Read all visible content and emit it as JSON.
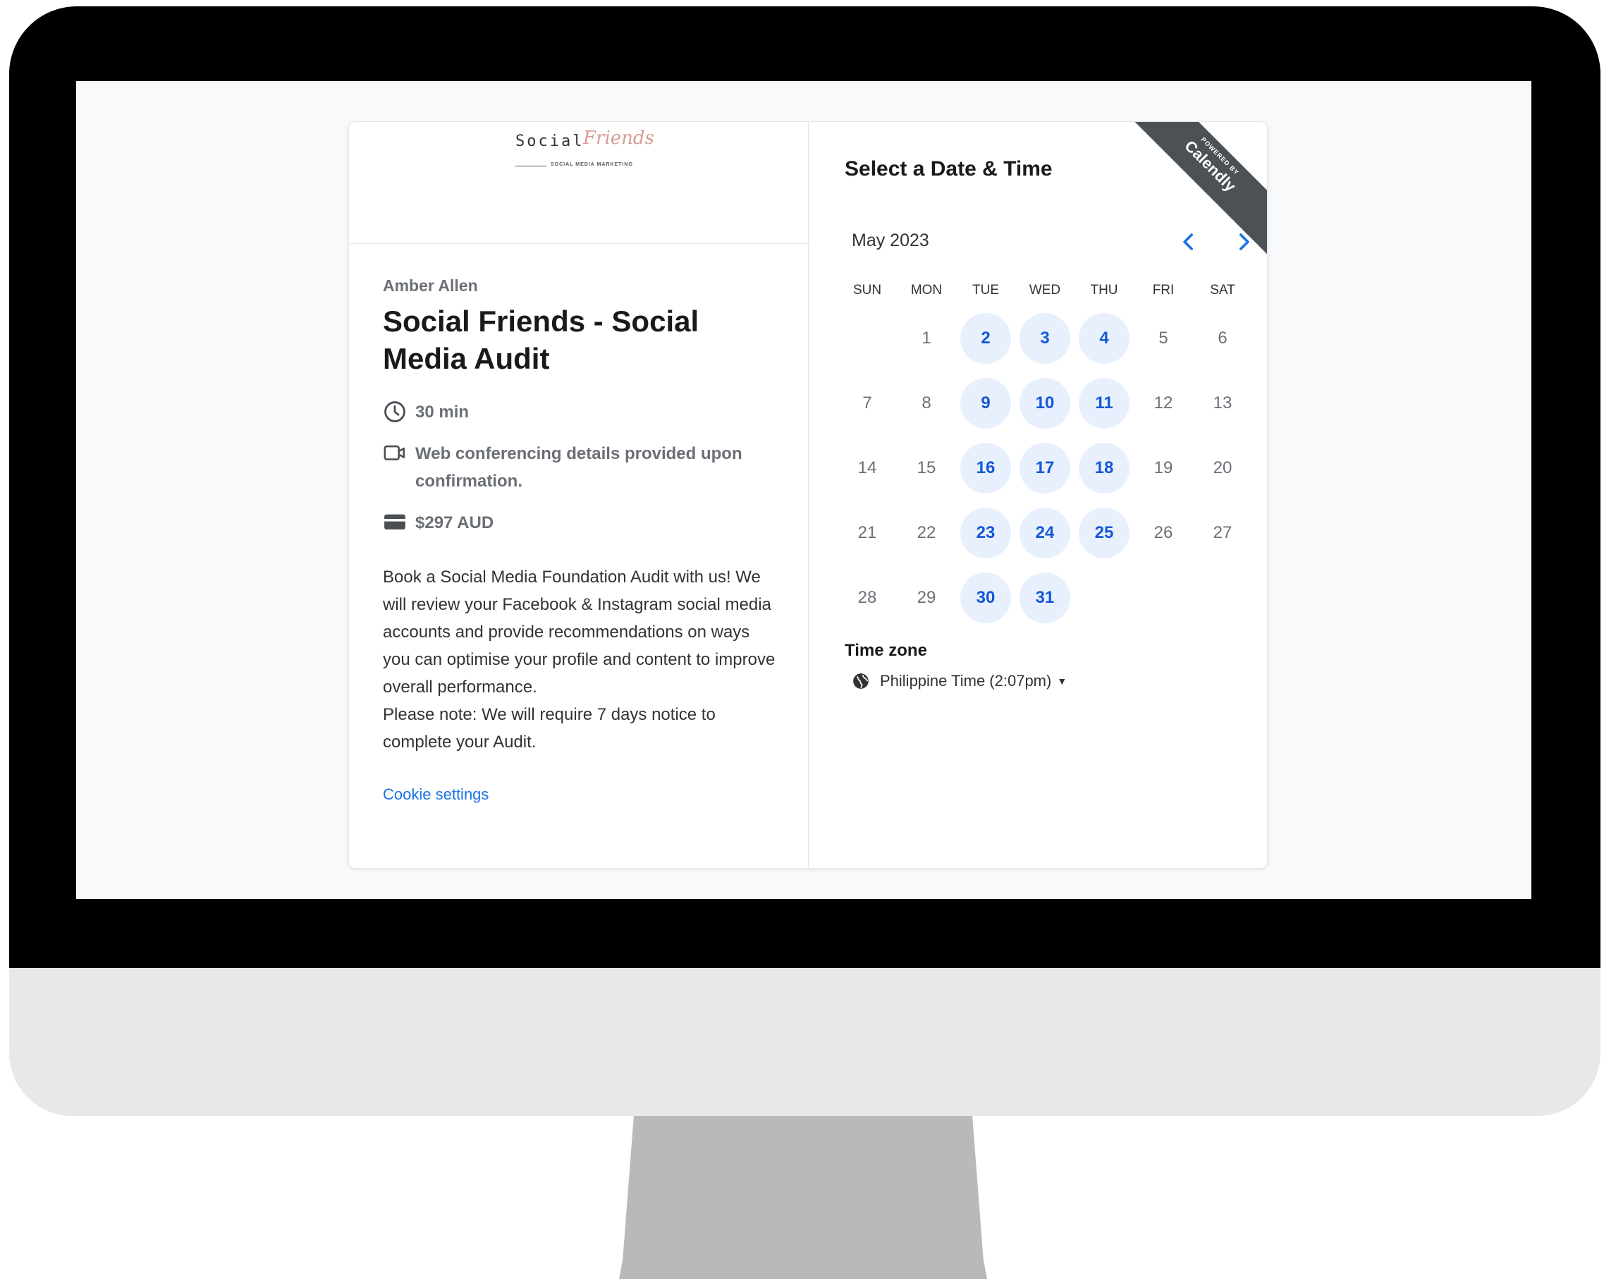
{
  "branding": {
    "logo_word": "Social",
    "logo_script": "Friends",
    "logo_tagline": "SOCIAL MEDIA MARKETING",
    "ribbon_line1": "POWERED BY",
    "ribbon_line2": "Calendly"
  },
  "event": {
    "organizer": "Amber Allen",
    "title": "Social Friends - Social Media Audit",
    "duration": "30 min",
    "location": "Web conferencing details provided upon confirmation.",
    "price": "$297 AUD",
    "description_lines": [
      "Book a Social Media Foundation Audit with us! We will review your Facebook & Instagram social media accounts and provide recommendations on ways you can optimise your profile and content to improve overall performance.",
      "Please note: We will require 7 days notice to complete your Audit."
    ],
    "cookie_link": "Cookie settings"
  },
  "calendar": {
    "title": "Select a Date & Time",
    "month": "May 2023",
    "prev_icon": "chevron-left-icon",
    "next_icon": "chevron-right-icon",
    "weekdays": [
      "SUN",
      "MON",
      "TUE",
      "WED",
      "THU",
      "FRI",
      "SAT"
    ],
    "weeks": [
      [
        null,
        "1",
        "2",
        "3",
        "4",
        "5",
        "6"
      ],
      [
        "7",
        "8",
        "9",
        "10",
        "11",
        "12",
        "13"
      ],
      [
        "14",
        "15",
        "16",
        "17",
        "18",
        "19",
        "20"
      ],
      [
        "21",
        "22",
        "23",
        "24",
        "25",
        "26",
        "27"
      ],
      [
        "28",
        "29",
        "30",
        "31",
        null,
        null,
        null
      ]
    ],
    "available_days": [
      "2",
      "3",
      "4",
      "9",
      "10",
      "11",
      "16",
      "17",
      "18",
      "23",
      "24",
      "25",
      "30",
      "31"
    ]
  },
  "timezone": {
    "label": "Time zone",
    "value": "Philippine Time (2:07pm)"
  },
  "colors": {
    "accent": "#1a73e8",
    "available_bg": "#e8f0fd",
    "available_text": "#1558d6",
    "ribbon": "#4c5156"
  }
}
